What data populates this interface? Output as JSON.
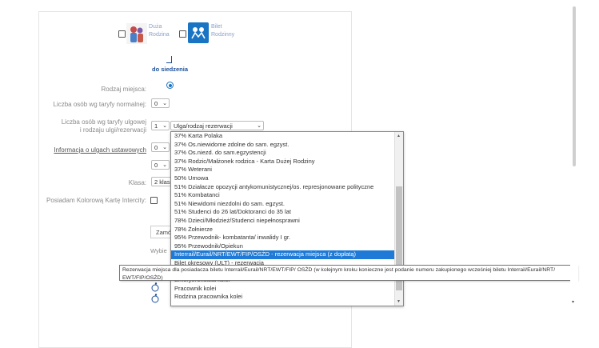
{
  "tiles": {
    "duza": {
      "line1": "Duża",
      "line2": "Rodzina"
    },
    "bilet": {
      "line1": "Bilet",
      "line2": "Rodzinny"
    }
  },
  "seat_link": {
    "label": "do siedzenia"
  },
  "form": {
    "rodzaj_miejsca": "Rodzaj miejsca:",
    "liczba_normalnej": "Liczba osób wg taryfy normalnej:",
    "liczba_normalnej_value": "0",
    "liczba_ulgowej_1": "Liczba osób wg taryfy ulgowej",
    "liczba_ulgowej_2": "i rodzaju ulgi/rezerwacji",
    "liczba_ulgowej_value": "1",
    "ulga_select": "Ulga/rodzaj rezerwacji",
    "info_ulgi": "Informacja o ulgach ustawowych",
    "extra_value_1": "0",
    "extra_value_2": "0",
    "klasa_label": "Klasa:",
    "klasa_value": "2 klas",
    "karta_label": "Posiadam Kolorową Kartę Intercity:",
    "zamo": "Zamó",
    "wybie": "Wybie"
  },
  "dropdown": {
    "items": [
      "37% Karta Polaka",
      "37% Os.niewidome zdolne do sam. egzyst.",
      "37% Os.niezd. do sam.egzystencji",
      "37% Rodzic/Małżonek rodzica - Karta Dużej Rodziny",
      "37% Weterani",
      "50% Umowa",
      "51% Działacze opozycji antykomunistycznej/os. represjonowane polityczne",
      "51% Kombatanci",
      "51% Niewidomi niezdolni do sam. egzyst.",
      "51% Studenci do 26 lat/Doktoranci do 35 lat",
      "78% Dzieci/Młodzież/Studenci niepełnosprawni",
      "78% Żołnierze",
      "95% Przewodnik- kombatanta/ inwalidy I gr.",
      "95% Przewodnik/Opiekun",
      "Interrail/Eurail/NRT/EWT/FIP/OSŻD - rezerwacja miejsca (z dopłatą)",
      "Bilet okresowy (ULT) - rezerwacja",
      "",
      "Emeryt/rencista kolei",
      "Pracownik kolei",
      "Rodzina pracownika kolei"
    ],
    "selected_index": 14
  },
  "tooltip": {
    "text": "Rezerwacja miejsca dla posiadacza biletu Interrail/Eurail/NRT/EWT/FIP/ OSŻD (w kolejnym kroku konieczne jest podanie numeru zakupionego wcześniej biletu Interrail/Eurail/NRT/ EWT/FIP/OSŻD)"
  },
  "colors": {
    "accent": "#1a74c4",
    "selection": "#1e7ad6"
  }
}
